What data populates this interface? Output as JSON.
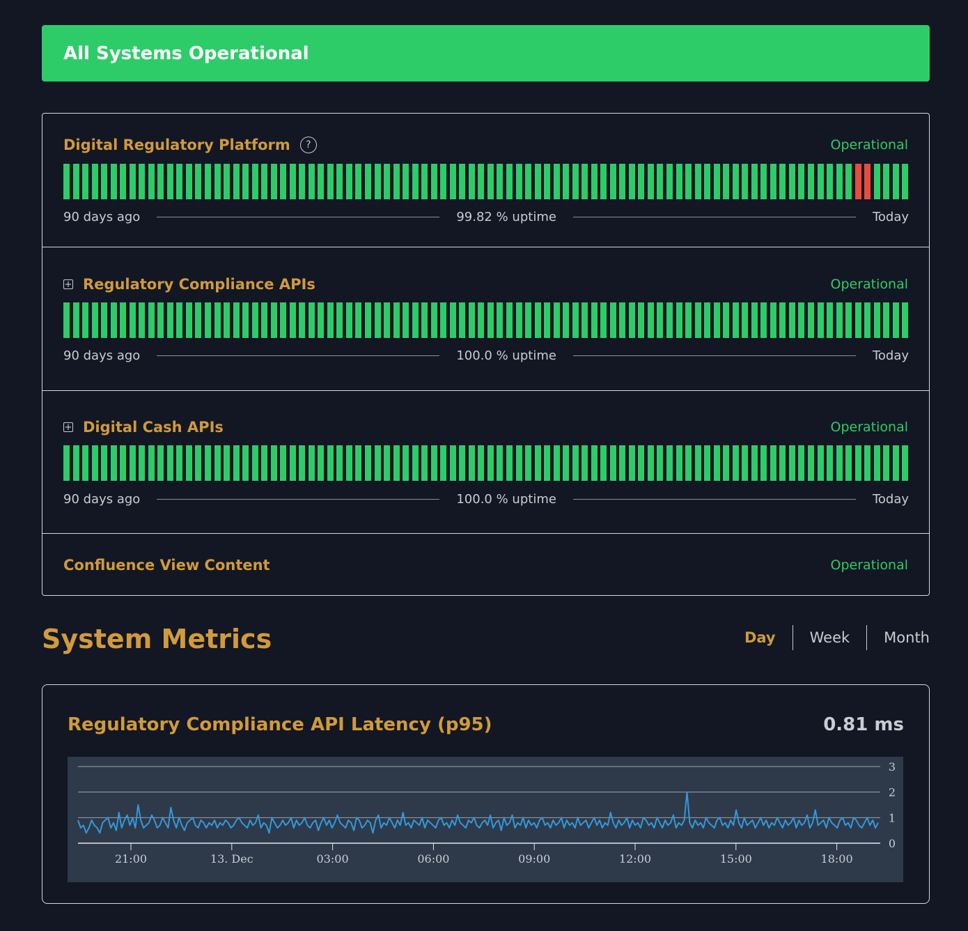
{
  "banner": {
    "text": "All Systems Operational"
  },
  "components": [
    {
      "name": "Digital Regulatory Platform",
      "status": "Operational",
      "has_help": true,
      "expandable": false,
      "uptime": "99.82 % uptime",
      "start": "90 days ago",
      "end": "Today",
      "down_days": [
        84,
        85
      ]
    },
    {
      "name": "Regulatory Compliance APIs",
      "status": "Operational",
      "has_help": false,
      "expandable": true,
      "uptime": "100.0 % uptime",
      "start": "90 days ago",
      "end": "Today",
      "down_days": []
    },
    {
      "name": "Digital Cash APIs",
      "status": "Operational",
      "has_help": false,
      "expandable": true,
      "uptime": "100.0 % uptime",
      "start": "90 days ago",
      "end": "Today",
      "down_days": []
    },
    {
      "name": "Confluence View Content",
      "status": "Operational",
      "has_help": false,
      "expandable": false
    }
  ],
  "metrics": {
    "title": "System Metrics",
    "ranges": [
      "Day",
      "Week",
      "Month"
    ],
    "active_range": "Day",
    "card": {
      "name": "Regulatory Compliance API Latency (p95)",
      "value": "0.81 ms"
    }
  },
  "colors": {
    "ok": "#2ecc68",
    "down": "#e74c3c",
    "accent": "#d19a3b",
    "line": "#3498db"
  },
  "chart_data": {
    "type": "line",
    "x_ticks": [
      "21:00",
      "13. Dec",
      "03:00",
      "06:00",
      "09:00",
      "12:00",
      "15:00",
      "18:00"
    ],
    "y_ticks": [
      0,
      1,
      2,
      3
    ],
    "ylim": [
      0,
      3
    ],
    "series": [
      {
        "values": [
          0.9,
          0.6,
          0.7,
          0.4,
          0.6,
          0.9,
          0.7,
          0.6,
          0.4,
          0.8,
          0.9,
          1.0,
          0.6,
          0.8,
          0.5,
          1.2,
          0.6,
          0.9,
          1.1,
          0.7,
          1.0,
          0.6,
          1.5,
          0.9,
          0.6,
          0.7,
          0.8,
          1.1,
          0.9,
          0.6,
          0.7,
          1.0,
          0.8,
          0.6,
          1.4,
          0.9,
          0.6,
          1.0,
          0.7,
          0.5,
          0.8,
          0.9,
          1.0,
          0.7,
          0.6,
          0.9,
          0.8,
          0.6,
          0.8,
          0.7,
          0.9,
          0.6,
          0.8,
          0.7,
          0.9,
          0.8,
          0.6,
          0.7,
          0.9,
          1.0,
          0.8,
          0.7,
          0.6,
          0.9,
          0.7,
          0.8,
          1.1,
          0.6,
          0.8,
          0.7,
          0.4,
          1.0,
          0.8,
          0.6,
          0.7,
          0.9,
          0.7,
          0.8,
          1.0,
          0.6,
          0.9,
          0.7,
          0.8,
          1.0,
          0.7,
          0.6,
          0.8,
          0.9,
          0.5,
          0.8,
          1.0,
          0.7,
          0.9,
          0.6,
          0.8,
          1.1,
          0.8,
          0.7,
          0.6,
          0.9,
          0.8,
          0.5,
          1.0,
          0.9,
          0.6,
          0.7,
          0.9,
          0.8,
          0.4,
          0.9,
          1.1,
          0.6,
          0.8,
          0.7,
          1.0,
          0.8,
          0.6,
          0.9,
          0.7,
          1.2,
          0.7,
          0.8,
          0.6,
          0.9,
          0.8,
          0.7,
          1.0,
          0.6,
          0.9,
          0.8,
          0.7,
          0.6,
          0.9,
          1.0,
          0.7,
          0.8,
          0.6,
          0.9,
          0.7,
          1.1,
          0.8,
          0.7,
          0.6,
          0.9,
          0.8,
          1.0,
          0.7,
          0.6,
          0.8,
          0.9,
          0.7,
          1.1,
          0.6,
          0.8,
          0.9,
          0.5,
          1.0,
          0.7,
          0.8,
          1.1,
          0.6,
          0.8,
          0.7,
          1.0,
          0.6,
          0.9,
          0.7,
          0.8,
          0.6,
          0.9,
          1.0,
          0.7,
          0.8,
          0.6,
          0.9,
          0.7,
          0.8,
          1.0,
          0.6,
          0.9,
          0.7,
          0.8,
          0.6,
          1.0,
          0.7,
          0.8,
          0.9,
          0.6,
          0.8,
          1.0,
          0.7,
          0.9,
          0.6,
          0.8,
          0.7,
          1.2,
          0.8,
          0.6,
          0.9,
          0.7,
          0.8,
          1.0,
          0.6,
          0.9,
          0.7,
          0.8,
          0.6,
          1.0,
          0.9,
          0.7,
          0.8,
          0.6,
          1.0,
          0.8,
          0.6,
          0.9,
          0.7,
          0.8,
          1.1,
          0.6,
          0.8,
          0.7,
          0.9,
          2.0,
          0.8,
          0.6,
          0.9,
          0.7,
          0.8,
          0.6,
          1.0,
          0.8,
          0.7,
          0.6,
          0.9,
          1.0,
          0.7,
          0.8,
          0.6,
          0.9,
          0.7,
          1.3,
          0.8,
          0.6,
          1.0,
          0.7,
          0.8,
          0.9,
          0.6,
          0.8,
          1.0,
          0.7,
          0.9,
          0.6,
          0.8,
          0.7,
          1.0,
          0.8,
          0.6,
          0.9,
          0.7,
          0.8,
          1.0,
          0.6,
          0.9,
          0.7,
          0.8,
          1.1,
          0.6,
          0.8,
          1.3,
          0.7,
          0.8,
          0.9,
          0.6,
          1.0,
          0.8,
          0.7,
          0.6,
          0.9,
          1.0,
          0.7,
          0.8,
          0.6,
          1.0,
          0.9,
          0.7,
          0.6,
          0.8,
          1.0,
          0.7,
          0.9,
          0.6,
          0.8
        ]
      }
    ]
  }
}
